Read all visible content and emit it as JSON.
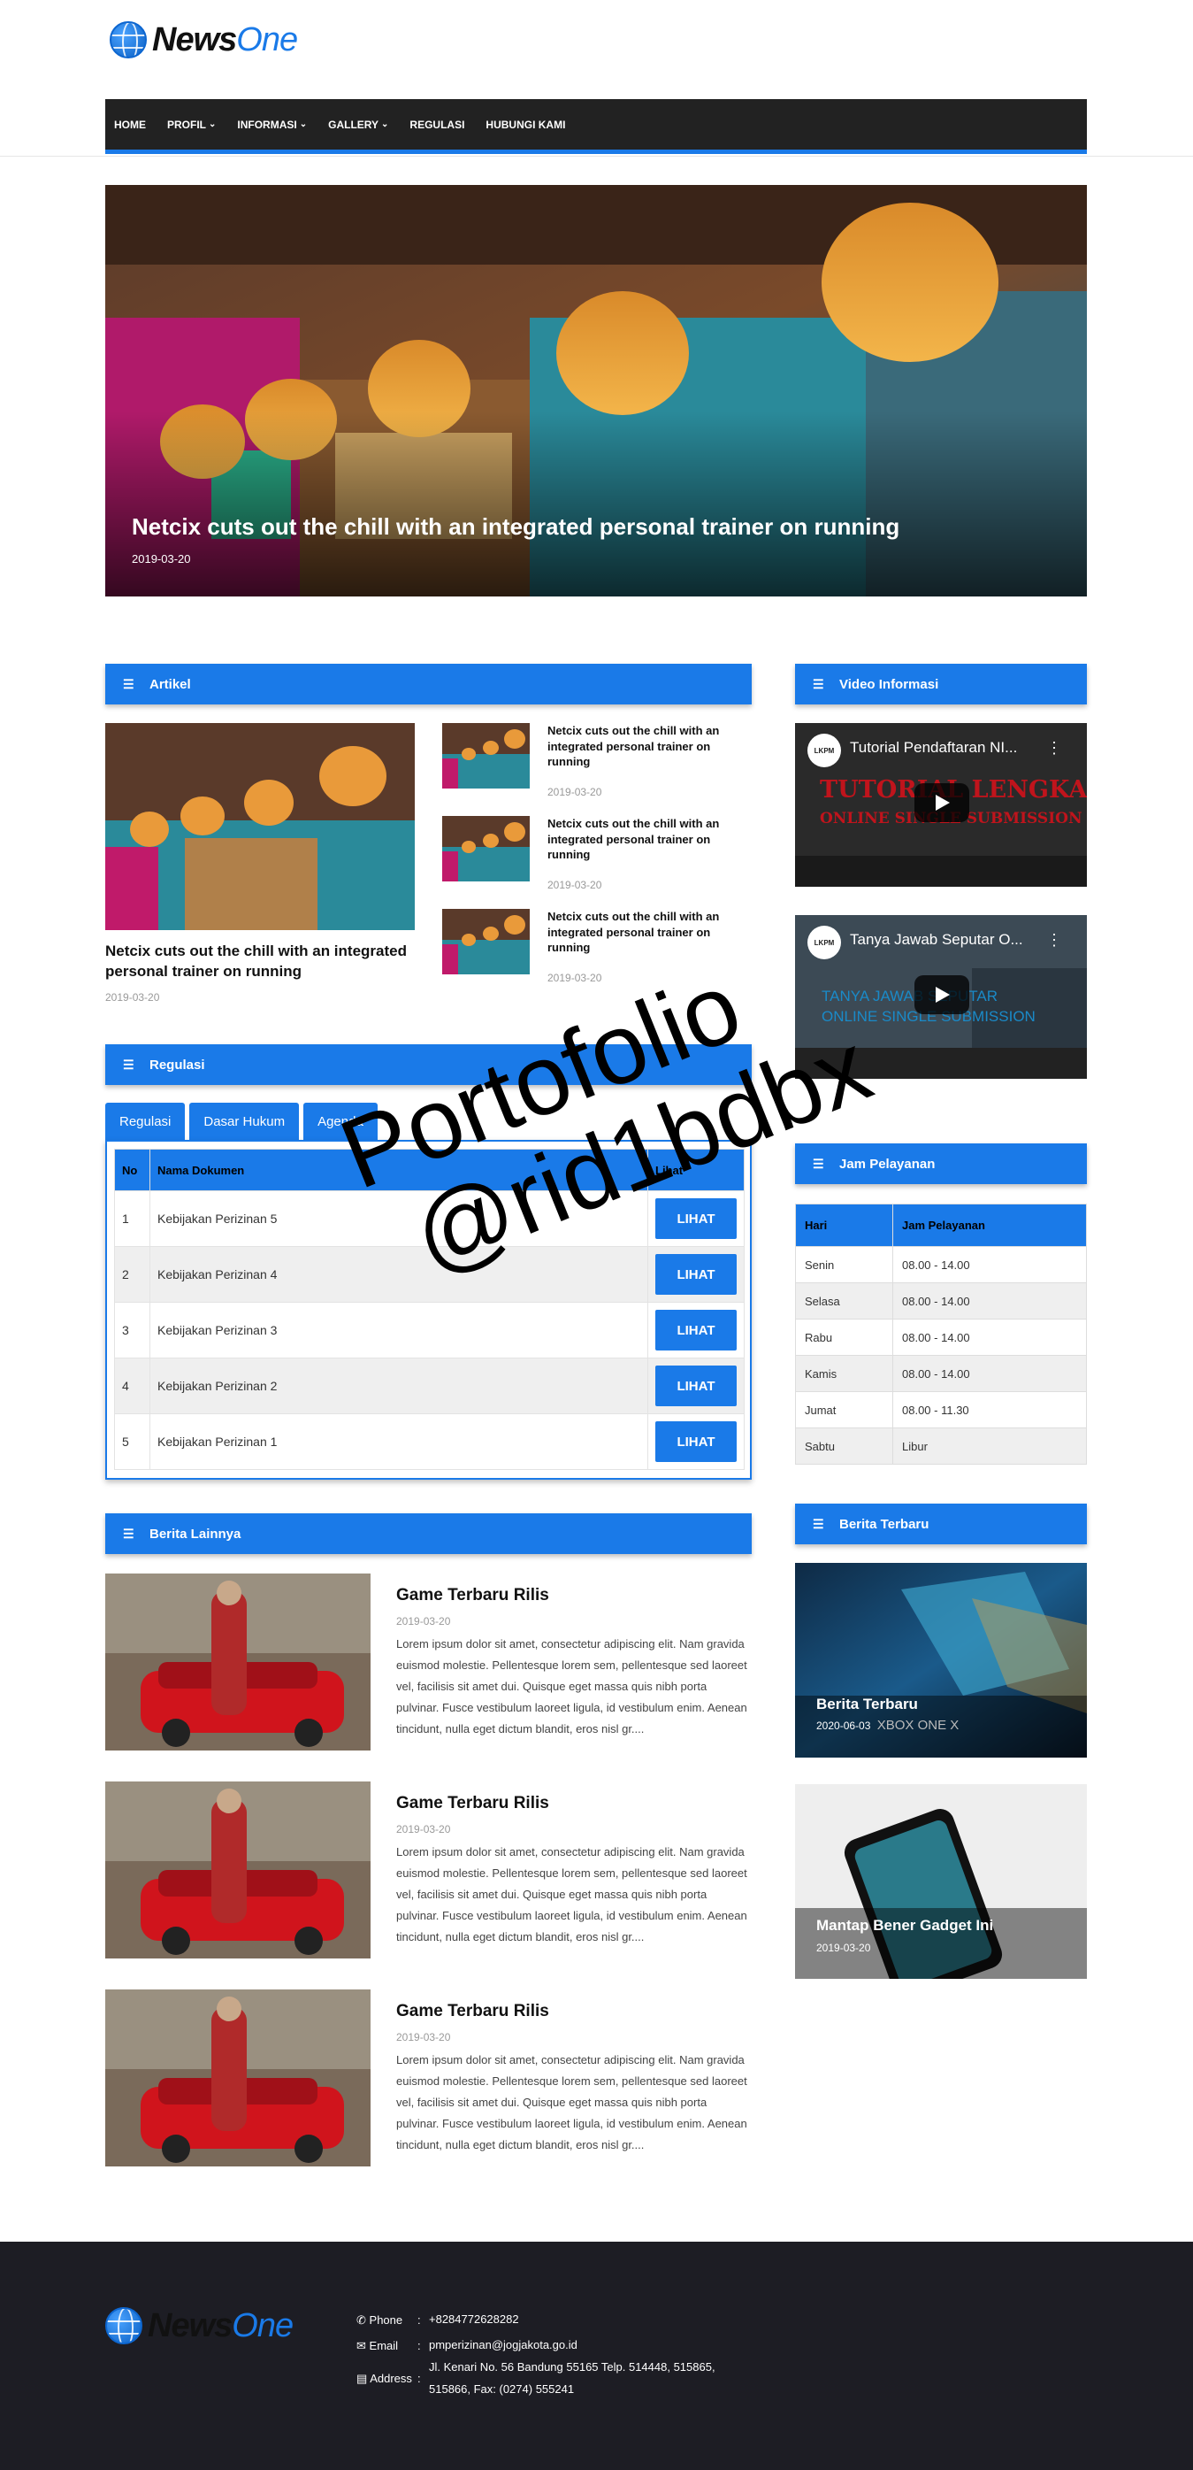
{
  "logo": {
    "part1": "News",
    "part2": "One"
  },
  "nav": {
    "items": [
      {
        "label": "HOME",
        "dropdown": false
      },
      {
        "label": "PROFIL",
        "dropdown": true
      },
      {
        "label": "INFORMASI",
        "dropdown": true
      },
      {
        "label": "GALLERY",
        "dropdown": true
      },
      {
        "label": "REGULASI",
        "dropdown": false
      },
      {
        "label": "HUBUNGI KAMI",
        "dropdown": false
      }
    ]
  },
  "hero": {
    "title": "Netcix cuts out the chill with an integrated personal trainer on running",
    "date": "2019-03-20"
  },
  "artikel": {
    "heading": "Artikel",
    "main": {
      "title": "Netcix cuts out the chill with an integrated personal trainer on running",
      "date": "2019-03-20"
    },
    "list": [
      {
        "title": "Netcix cuts out the chill with an integrated personal trainer on running",
        "date": "2019-03-20"
      },
      {
        "title": "Netcix cuts out the chill with an integrated personal trainer on running",
        "date": "2019-03-20"
      },
      {
        "title": "Netcix cuts out the chill with an integrated personal trainer on running",
        "date": "2019-03-20"
      }
    ]
  },
  "video": {
    "heading": "Video Informasi",
    "items": [
      {
        "title": "Tutorial Pendaftaran NI...",
        "logo": "LKPM",
        "overlay1": "TUTORIAL LENGKAP",
        "overlay2": "ONLINE SINGLE SUBMISSION"
      },
      {
        "title": "Tanya Jawab Seputar O...",
        "logo": "LKPM",
        "overlay1": "TANYA JAWAB SEPUTAR",
        "overlay2": "ONLINE SINGLE SUBMISSION"
      }
    ]
  },
  "regulasi": {
    "heading": "Regulasi",
    "tabs": [
      "Regulasi",
      "Dasar Hukum",
      "Agenda"
    ],
    "columns": [
      "No",
      "Nama Dokumen",
      "Lihat"
    ],
    "rows": [
      {
        "no": "1",
        "name": "Kebijakan Perizinan 5",
        "action": "LIHAT"
      },
      {
        "no": "2",
        "name": "Kebijakan Perizinan 4",
        "action": "LIHAT"
      },
      {
        "no": "3",
        "name": "Kebijakan Perizinan 3",
        "action": "LIHAT"
      },
      {
        "no": "4",
        "name": "Kebijakan Perizinan 2",
        "action": "LIHAT"
      },
      {
        "no": "5",
        "name": "Kebijakan Perizinan 1",
        "action": "LIHAT"
      }
    ]
  },
  "jam": {
    "heading": "Jam Pelayanan",
    "columns": [
      "Hari",
      "Jam Pelayanan"
    ],
    "rows": [
      {
        "day": "Senin",
        "hours": "08.00 - 14.00"
      },
      {
        "day": "Selasa",
        "hours": "08.00 - 14.00"
      },
      {
        "day": "Rabu",
        "hours": "08.00 - 14.00"
      },
      {
        "day": "Kamis",
        "hours": "08.00 - 14.00"
      },
      {
        "day": "Jumat",
        "hours": "08.00 - 11.30"
      },
      {
        "day": "Sabtu",
        "hours": "Libur"
      }
    ]
  },
  "berita_lainnya": {
    "heading": "Berita Lainnya",
    "items": [
      {
        "title": "Game Terbaru Rilis",
        "date": "2019-03-20",
        "text": "Lorem ipsum dolor sit amet, consectetur adipiscing elit. Nam gravida euismod molestie. Pellentesque lorem sem, pellentesque sed laoreet vel, facilisis sit amet dui. Quisque eget massa quis nibh porta pulvinar. Fusce vestibulum laoreet ligula, id vestibulum enim. Aenean tincidunt, nulla eget dictum blandit, eros nisl gr...."
      },
      {
        "title": "Game Terbaru Rilis",
        "date": "2019-03-20",
        "text": "Lorem ipsum dolor sit amet, consectetur adipiscing elit. Nam gravida euismod molestie. Pellentesque lorem sem, pellentesque sed laoreet vel, facilisis sit amet dui. Quisque eget massa quis nibh porta pulvinar. Fusce vestibulum laoreet ligula, id vestibulum enim. Aenean tincidunt, nulla eget dictum blandit, eros nisl gr...."
      },
      {
        "title": "Game Terbaru Rilis",
        "date": "2019-03-20",
        "text": "Lorem ipsum dolor sit amet, consectetur adipiscing elit. Nam gravida euismod molestie. Pellentesque lorem sem, pellentesque sed laoreet vel, facilisis sit amet dui. Quisque eget massa quis nibh porta pulvinar. Fusce vestibulum laoreet ligula, id vestibulum enim. Aenean tincidunt, nulla eget dictum blandit, eros nisl gr...."
      }
    ]
  },
  "berita_terbaru": {
    "heading": "Berita Terbaru",
    "items": [
      {
        "title": "Berita Terbaru",
        "date": "2020-06-03",
        "extra": "XBOX ONE X"
      },
      {
        "title": "Mantap Bener Gadget Ini",
        "date": "2019-03-20"
      }
    ]
  },
  "footer": {
    "phone_label": "Phone",
    "phone": "+8284772628282",
    "email_label": "Email",
    "email": "pmperizinan@jogjakota.go.id",
    "address_label": "Address",
    "address_line1": "Jl. Kenari No. 56 Bandung 55165 Telp. 514448, 515865,",
    "address_line2": "515866, Fax: (0274) 555241",
    "separator": ":"
  },
  "watermark": {
    "line1": "Portofolio",
    "line2": "@rid1bdbx"
  },
  "colors": {
    "accent": "#1a7ae8",
    "nav_bg": "#222222",
    "footer_bg": "#1d1d24"
  }
}
